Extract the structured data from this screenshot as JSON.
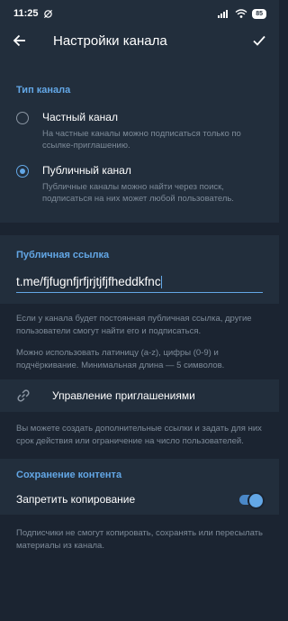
{
  "status_bar": {
    "time": "11:25",
    "battery": "85"
  },
  "app_bar": {
    "title": "Настройки канала"
  },
  "channel_type": {
    "header": "Тип канала",
    "private": {
      "title": "Частный канал",
      "desc": "На частные каналы можно подписаться только по ссылке-приглашению.",
      "selected": false
    },
    "public": {
      "title": "Публичный канал",
      "desc": "Публичные каналы можно найти через поиск, подписаться на них может любой пользователь.",
      "selected": true
    }
  },
  "public_link": {
    "header": "Публичная ссылка",
    "value": "t.me/fjfugnfjrfjrjtjfjfheddkfnc"
  },
  "link_info": {
    "p1": "Если у канала будет постоянная публичная ссылка, другие пользователи смогут найти его и подписаться.",
    "p2": "Можно использовать латиницу (a-z), цифры (0-9) и подчёркивание. Минимальная длина — 5 символов."
  },
  "invites": {
    "label": "Управление приглашениями",
    "info": "Вы можете создать дополнительные ссылки и задать для них срок действия или ограничение на число пользователей."
  },
  "content_saving": {
    "header": "Сохранение контента",
    "toggle_label": "Запретить копирование",
    "toggle_on": true,
    "info": "Подписчики не смогут копировать, сохранять или пересылать материалы из канала."
  },
  "colors": {
    "accent": "#63a7e6",
    "background": "#1b2431",
    "surface": "#222e3c",
    "secondary_text": "#7e8b99"
  },
  "icons": [
    "arrow-back-icon",
    "check-icon",
    "link-icon",
    "wifi-icon",
    "signal-icon",
    "battery-icon",
    "mute-icon"
  ]
}
